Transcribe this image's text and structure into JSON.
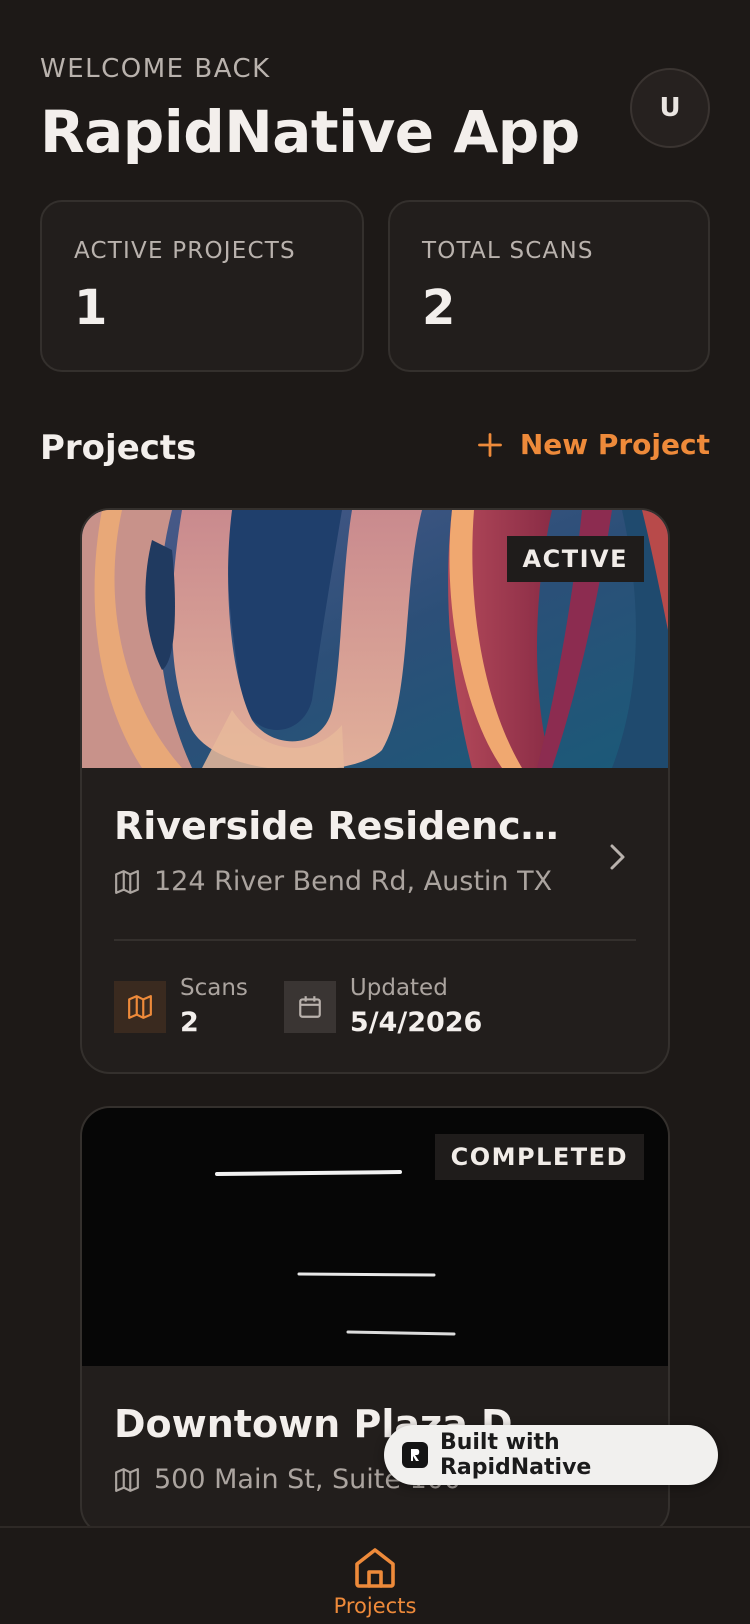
{
  "header": {
    "welcome": "WELCOME BACK",
    "title": "RapidNative App",
    "avatar_initial": "U"
  },
  "stats": [
    {
      "label": "ACTIVE PROJECTS",
      "value": "1"
    },
    {
      "label": "TOTAL SCANS",
      "value": "2"
    }
  ],
  "projects_section": {
    "title": "Projects",
    "new_project_label": "New Project"
  },
  "projects": [
    {
      "status": "ACTIVE",
      "title": "Riverside Residence ...",
      "address": "124 River Bend Rd, Austin TX",
      "scans_label": "Scans",
      "scans_value": "2",
      "updated_label": "Updated",
      "updated_value": "5/4/2026"
    },
    {
      "status": "COMPLETED",
      "title": "Downtown Plaza Drai...",
      "address": "500 Main St, Suite 100"
    }
  ],
  "built_with": {
    "label": "Built with RapidNative"
  },
  "tabbar": {
    "tabs": [
      {
        "label": "Projects",
        "icon": "home-icon"
      }
    ]
  },
  "colors": {
    "accent": "#ee8a3a",
    "background": "#1d1917",
    "card": "#221e1c"
  }
}
